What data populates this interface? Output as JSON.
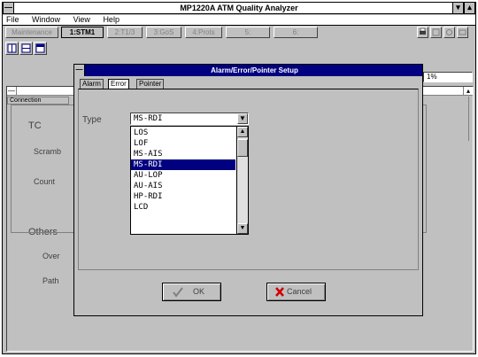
{
  "window": {
    "title": "MP1220A ATM Quality Analyzer",
    "sys_menu": "—",
    "min": "▾",
    "max": "▴"
  },
  "menu": [
    "File",
    "Window",
    "View",
    "Help"
  ],
  "toolbar": {
    "tabs": [
      "Maintenance",
      "1:STM1",
      "2:T1/3",
      "3:GoS",
      "4:Prots",
      "5:",
      "6:"
    ],
    "zoom_value": "1%"
  },
  "document": {
    "tab": "Connection",
    "tc_label": "TC",
    "scrambling_label": "Scramb",
    "count_label": "Count",
    "others_label": "Others",
    "over_label": "Over",
    "path_label": "Path"
  },
  "dialog": {
    "title": "Alarm/Error/Pointer Setup",
    "tabs": [
      "Alarm",
      "Error",
      "Pointer"
    ],
    "type_label": "Type",
    "type_value": "MS-RDI",
    "options": [
      "LOS",
      "LOF",
      "MS-AIS",
      "MS-RDI",
      "AU-LOP",
      "AU-AIS",
      "HP-RDI",
      "LCD"
    ],
    "selected_index": 3,
    "ok_label": "OK",
    "cancel_label": "Cancel"
  },
  "colors": {
    "selection": "#000080",
    "titlebar_active": "#000080",
    "face": "#c0c0c0"
  }
}
